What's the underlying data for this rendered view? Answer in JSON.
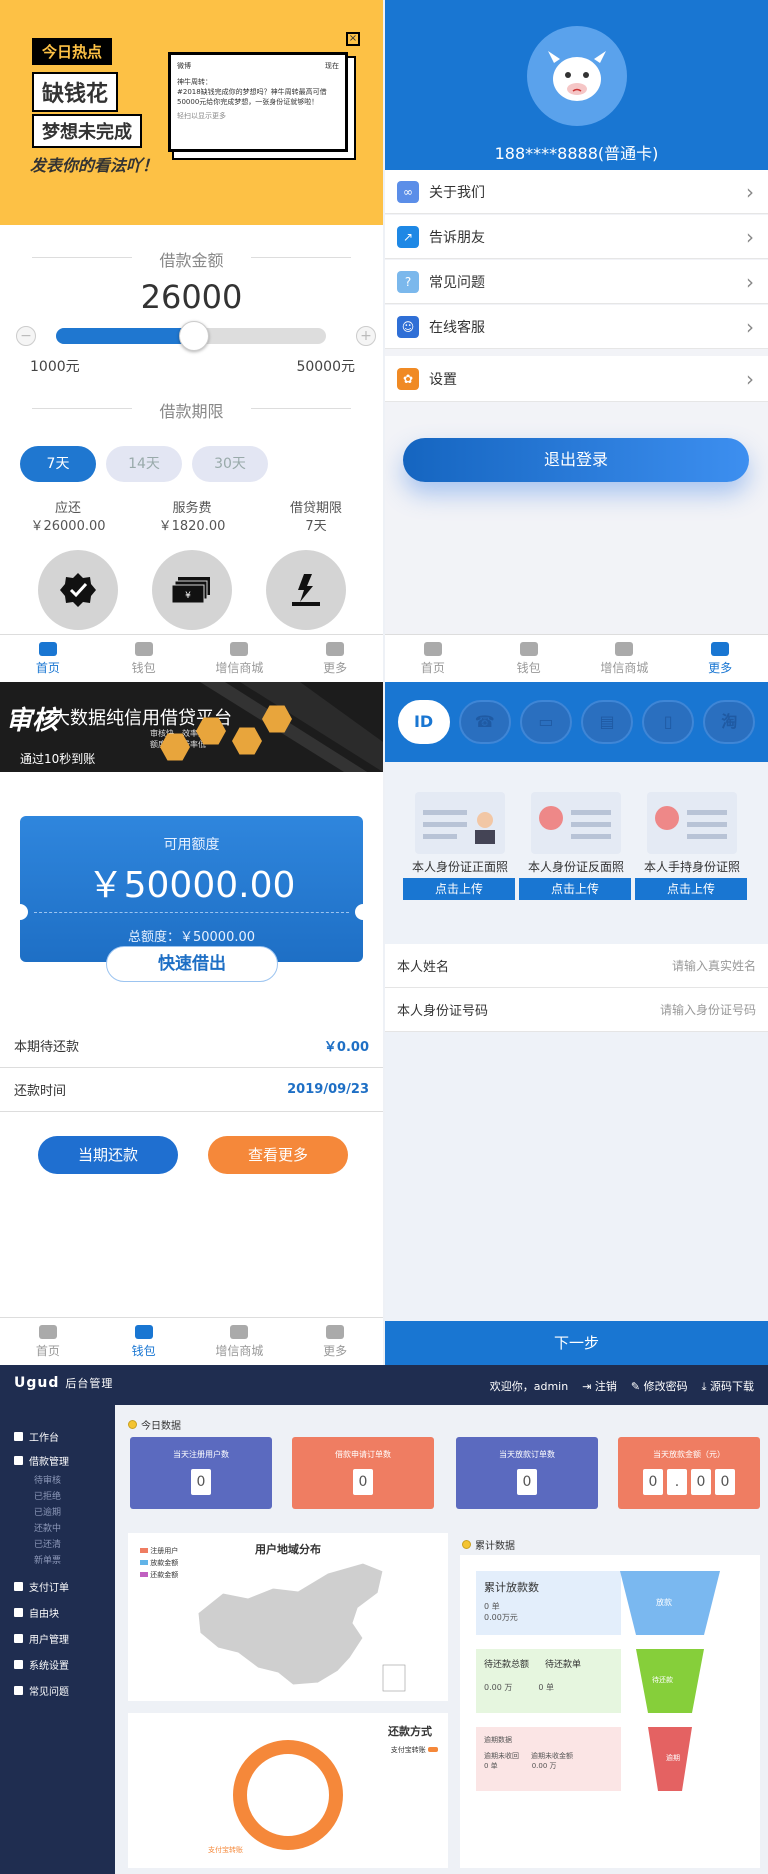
{
  "p1": {
    "banner": {
      "tag": "今日热点",
      "line1": "缺钱花",
      "line2": "梦想未完成",
      "footer": "发表你的看法吖！",
      "card_source": "微博",
      "card_time": "现在",
      "card_user": "神牛周转：",
      "card_text": "#2018缺钱完成你的梦想吗？神牛周转最高可借50000元给你完成梦想，一张身份证就够啦！",
      "card_more": "轻扫以显示更多",
      "close": "×"
    },
    "loan_amount_title": "借款金额",
    "amount": "26000",
    "slider": {
      "min_label": "1000元",
      "max_label": "50000元",
      "min": 1000,
      "max": 50000,
      "value": 26000,
      "minus": "−",
      "plus": "+"
    },
    "loan_term_title": "借款期限",
    "durations": [
      "7天",
      "14天",
      "30天"
    ],
    "info": [
      {
        "label": "应还",
        "value": "￥26000.00"
      },
      {
        "label": "服务费",
        "value": "￥1820.00"
      },
      {
        "label": "借贷期限",
        "value": "7天"
      }
    ],
    "tabs": [
      "首页",
      "钱包",
      "增信商城",
      "更多"
    ]
  },
  "p2": {
    "phone": "188****8888(普通卡)",
    "menu": [
      {
        "label": "关于我们",
        "color": "#5b8ee8",
        "icon": "link-icon"
      },
      {
        "label": "告诉朋友",
        "color": "#1e88e5",
        "icon": "share-icon"
      },
      {
        "label": "常见问题",
        "color": "#7bb8ec",
        "icon": "question-icon"
      },
      {
        "label": "在线客服",
        "color": "#2f6fd6",
        "icon": "chat-icon"
      },
      {
        "label": "设置",
        "color": "#f08a24",
        "icon": "gear-icon"
      }
    ],
    "logout": "退出登录",
    "tabs": [
      "首页",
      "钱包",
      "增信商城",
      "更多"
    ]
  },
  "p3": {
    "banner": {
      "title": "大数据纯信用借贷平台",
      "sub": "审核快，效率高\n额度高，费率低",
      "foot": "通过10秒到账"
    },
    "ticket": {
      "label": "可用额度",
      "amount": "￥50000.00",
      "total": "总额度：￥50000.00"
    },
    "quick": "快速借出",
    "rows": [
      {
        "label": "本期待还款",
        "value": "￥0.00"
      },
      {
        "label": "还款时间",
        "value": "2019/09/23"
      }
    ],
    "btn_repay": "当期还款",
    "btn_more": "查看更多",
    "tabs": [
      "首页",
      "钱包",
      "增信商城",
      "更多"
    ]
  },
  "p4": {
    "icons": [
      "ID",
      "☎",
      "▭",
      "▤",
      "▯",
      "淘"
    ],
    "cards": [
      {
        "caption": "本人身份证正面照",
        "button": "点击上传"
      },
      {
        "caption": "本人身份证反面照",
        "button": "点击上传"
      },
      {
        "caption": "本人手持身份证照",
        "button": "点击上传"
      }
    ],
    "fields": [
      {
        "label": "本人姓名",
        "placeholder": "请输入真实姓名"
      },
      {
        "label": "本人身份证号码",
        "placeholder": "请输入身份证号码"
      }
    ],
    "next": "下一步"
  },
  "p5": {
    "logo": "Ugud",
    "logo_sub": "后台管理",
    "welcome": "欢迎你，admin",
    "logout": "注销",
    "change_pwd": "修改密码",
    "download": "源码下载",
    "nav": [
      "工作台",
      "借款管理",
      "支付订单",
      "自由块",
      "用户管理",
      "系统设置",
      "常见问题"
    ],
    "subnav": [
      "待审核",
      "已拒绝",
      "已逾期",
      "还款中",
      "已还清",
      "新单票"
    ],
    "today_label": "今日数据",
    "stats": [
      {
        "label": "当天注册用户数",
        "digits": [
          "0"
        ],
        "color": "#5b6abf"
      },
      {
        "label": "借款申请订单数",
        "digits": [
          "0"
        ],
        "color": "#ef7d62"
      },
      {
        "label": "当天放款订单数",
        "digits": [
          "0"
        ],
        "color": "#5b6abf"
      },
      {
        "label": "当天放款金额（元）",
        "digits": [
          "0",
          ".",
          "0",
          "0"
        ],
        "color": "#ef7d62"
      }
    ],
    "map_title": "用户地域分布",
    "map_legend": [
      "注册用户",
      "放款金额",
      "还款金额"
    ],
    "cumulative_label": "累计数据",
    "cum": [
      {
        "title": "累计放款数",
        "line1": "0 单",
        "line2": "0.00万元",
        "tag": "放款"
      },
      {
        "title": "待还款总额",
        "title2": "待还款单",
        "line1": "0.00 万",
        "line2": "0 单",
        "tag": "待还款"
      },
      {
        "title": "逾期数据",
        "line1": "逾期未收回",
        "line1b": "逾期未收金额",
        "line2": "0 单",
        "line2b": "0.00 万",
        "tag": "逾期"
      }
    ],
    "repay_title": "还款方式",
    "repay_legend": "支付宝转账",
    "repay_label": "支付宝转账"
  }
}
